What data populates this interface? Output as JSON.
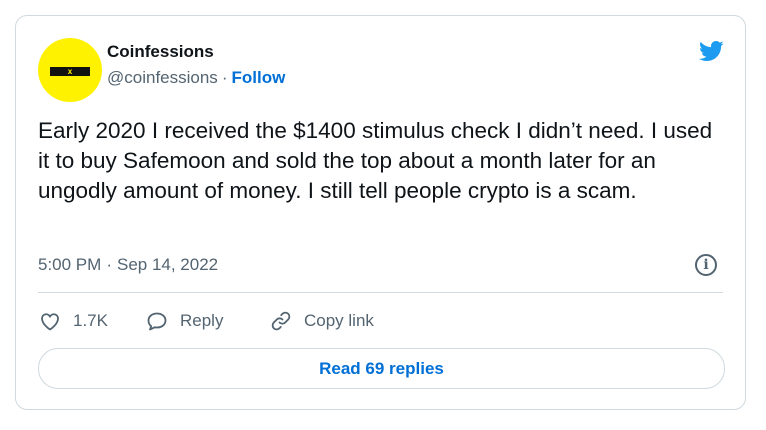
{
  "author": {
    "name": "Coinfessions",
    "handle": "@coinfessions",
    "follow_label": "Follow",
    "avatar_mark": "x",
    "avatar_color": "#fff200"
  },
  "separator": "·",
  "tweet": {
    "text": "Early 2020 I received the $1400 stimulus check I didn’t need. I used it to buy Safemoon and sold the top about a month later for an ungodly amount of money. I still tell people crypto is a scam.",
    "time": "5:00 PM",
    "date": "Sep 14, 2022"
  },
  "info_glyph": "i",
  "actions": {
    "likes": "1.7K",
    "reply_label": "Reply",
    "copy_link_label": "Copy link"
  },
  "read_replies_label": "Read 69 replies",
  "icons": {
    "brand": "twitter-bird-icon",
    "like": "heart-icon",
    "reply": "speech-bubble-icon",
    "copy": "link-icon",
    "info": "info-icon"
  },
  "colors": {
    "brand_blue": "#1d9bf0",
    "link_blue": "#006fd6",
    "text": "#0f1419",
    "secondary": "#536471",
    "border": "#cfd9de"
  }
}
